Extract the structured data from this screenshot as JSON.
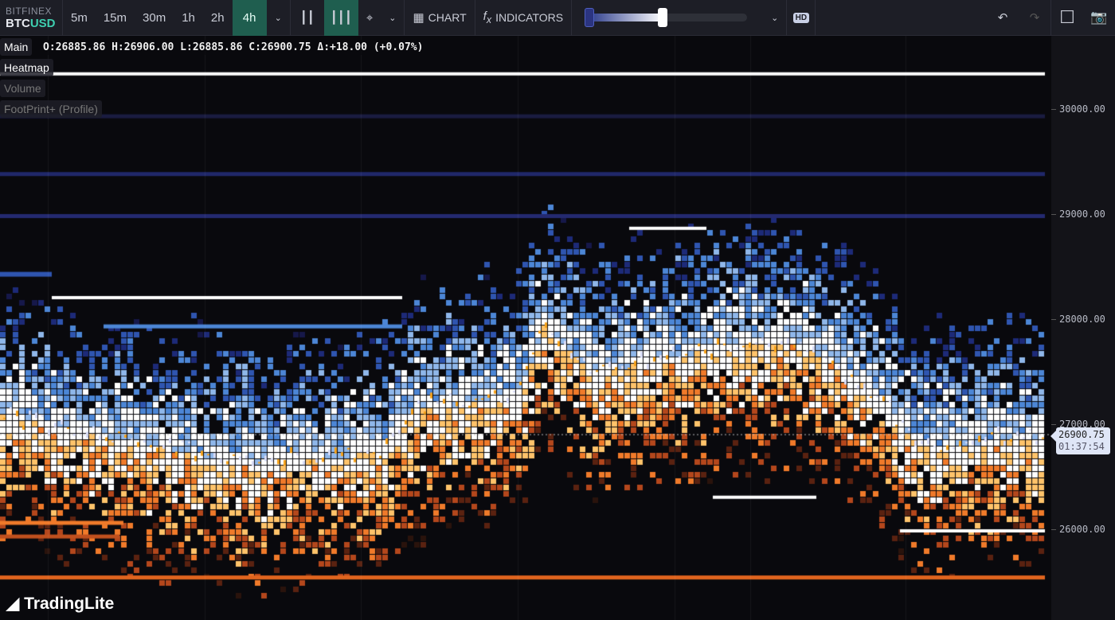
{
  "toolbar": {
    "exchange": "BITFINEX",
    "base": "BTC",
    "quote": "USD",
    "timeframes": [
      "5m",
      "15m",
      "30m",
      "1h",
      "2h",
      "4h"
    ],
    "active_timeframe": "4h",
    "chart_label": "CHART",
    "indicators_label": "INDICATORS",
    "hd_label": "HD",
    "slider_level": 0.47
  },
  "legend": {
    "main": "Main",
    "ohlc": "O:26885.86 H:26906.00 L:26885.86 C:26900.75 Δ:+18.00 (+0.07%)",
    "layers": [
      "Heatmap",
      "Volume",
      "FootPrint+ (Profile)"
    ]
  },
  "axis": {
    "ticks": [
      "30000.00",
      "29000.00",
      "28000.00",
      "27000.00",
      "26000.00"
    ]
  },
  "price_tag": {
    "price": "26900.75",
    "countdown": "01:37:54"
  },
  "brand": "TradingLite",
  "colors": {
    "accent": "#1f5e4f",
    "quote": "#3ecfb0",
    "bid": "#f7931a",
    "ask": "#3a6fd0"
  }
}
